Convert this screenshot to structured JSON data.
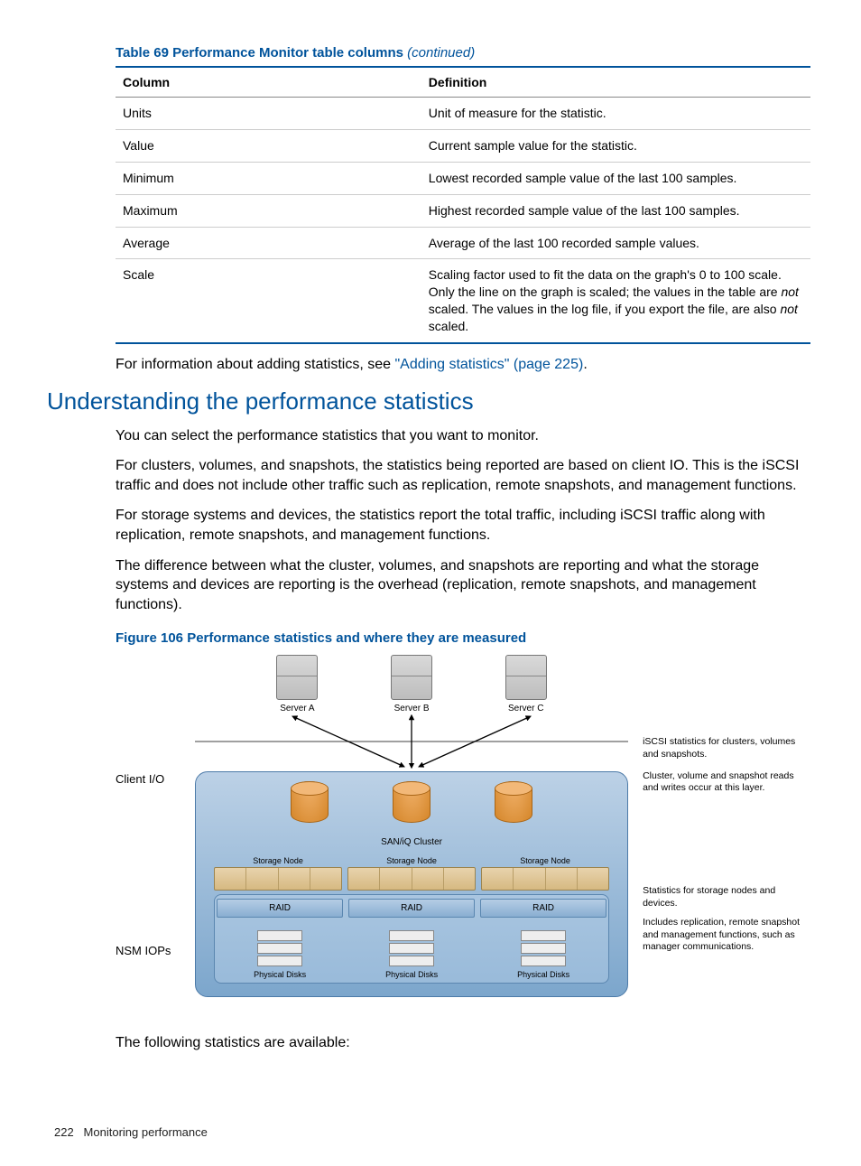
{
  "table": {
    "caption_prefix": "Table 69 Performance Monitor table columns ",
    "caption_suffix": "(continued)",
    "headers": [
      "Column",
      "Definition"
    ],
    "rows": [
      {
        "col": "Units",
        "def": "Unit of measure for the statistic."
      },
      {
        "col": "Value",
        "def": "Current sample value for the statistic."
      },
      {
        "col": "Minimum",
        "def": "Lowest recorded sample value of the last 100 samples."
      },
      {
        "col": "Maximum",
        "def": "Highest recorded sample value of the last 100 samples."
      },
      {
        "col": "Average",
        "def": "Average of the last 100 recorded sample values."
      },
      {
        "col": "Scale",
        "def_html": "Scaling factor used to fit the data on the graph's 0 to 100 scale. Only the line on the graph is scaled; the values in the table are <span class=\"ital\">not</span> scaled. The values in the log file, if you export the file, are also <span class=\"ital\">not</span> scaled."
      }
    ]
  },
  "para_link": {
    "pre": "For information about adding statistics, see ",
    "link": "\"Adding statistics\" (page 225)",
    "post": "."
  },
  "section_heading": "Understanding the performance statistics",
  "paras": [
    "You can select the performance statistics that you want to monitor.",
    "For clusters, volumes, and snapshots, the statistics being reported are based on client IO. This is the iSCSI traffic and does not include other traffic such as replication, remote snapshots, and management functions.",
    "For storage systems and devices, the statistics report the total traffic, including iSCSI traffic along with replication, remote snapshots, and management functions.",
    "The difference between what the cluster, volumes, and snapshots are reporting and what the storage systems and devices are reporting is the overhead (replication, remote snapshots, and management functions)."
  ],
  "figure_caption": "Figure 106 Performance statistics and where they are measured",
  "diagram": {
    "left_labels": {
      "client_io": "Client I/O",
      "nsm": "NSM IOPs"
    },
    "servers": [
      "Server A",
      "Server B",
      "Server C"
    ],
    "saniq": "SAN/iQ Cluster",
    "storage_node": "Storage Node",
    "raid": "RAID",
    "physical_disks": "Physical Disks",
    "notes": {
      "n1": "iSCSI statistics for clusters, volumes and snapshots.",
      "n2": "Cluster, volume and snapshot reads and writes occur at this layer.",
      "n3": "Statistics for storage nodes and devices.",
      "n4": "Includes replication, remote snapshot and management functions, such as manager communications."
    }
  },
  "closing": "The following statistics are available:",
  "footer": {
    "page": "222",
    "title": "Monitoring performance"
  }
}
